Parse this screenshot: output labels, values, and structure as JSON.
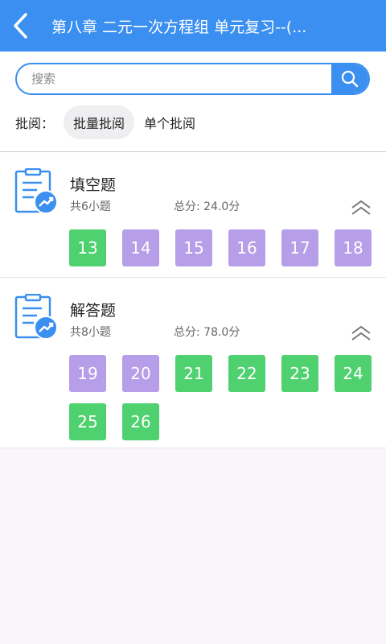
{
  "header": {
    "title": "第八章 二元一次方程组 单元复习--(..."
  },
  "search": {
    "placeholder": "搜索"
  },
  "review": {
    "label": "批阅：",
    "options": [
      "批量批阅",
      "单个批阅"
    ],
    "selected": "批量批阅"
  },
  "sections": [
    {
      "title": "填空题",
      "count": "共6小题",
      "score": "总分: 24.0分",
      "questions": [
        {
          "num": "13",
          "status": "green"
        },
        {
          "num": "14",
          "status": "purple"
        },
        {
          "num": "15",
          "status": "purple"
        },
        {
          "num": "16",
          "status": "purple"
        },
        {
          "num": "17",
          "status": "purple"
        },
        {
          "num": "18",
          "status": "purple"
        }
      ]
    },
    {
      "title": "解答题",
      "count": "共8小题",
      "score": "总分: 78.0分",
      "questions": [
        {
          "num": "19",
          "status": "purple"
        },
        {
          "num": "20",
          "status": "purple"
        },
        {
          "num": "21",
          "status": "green"
        },
        {
          "num": "22",
          "status": "green"
        },
        {
          "num": "23",
          "status": "green"
        },
        {
          "num": "24",
          "status": "green"
        },
        {
          "num": "25",
          "status": "green"
        },
        {
          "num": "26",
          "status": "green"
        }
      ]
    }
  ],
  "colors": {
    "accent": "#3a8ff0",
    "graded": "#4fd16f",
    "ungraded": "#b79ee8"
  },
  "icons": {
    "back": "chevron-left-icon",
    "search": "search-icon",
    "section": "clipboard-chart-icon",
    "collapse": "chevron-up-double-icon"
  }
}
